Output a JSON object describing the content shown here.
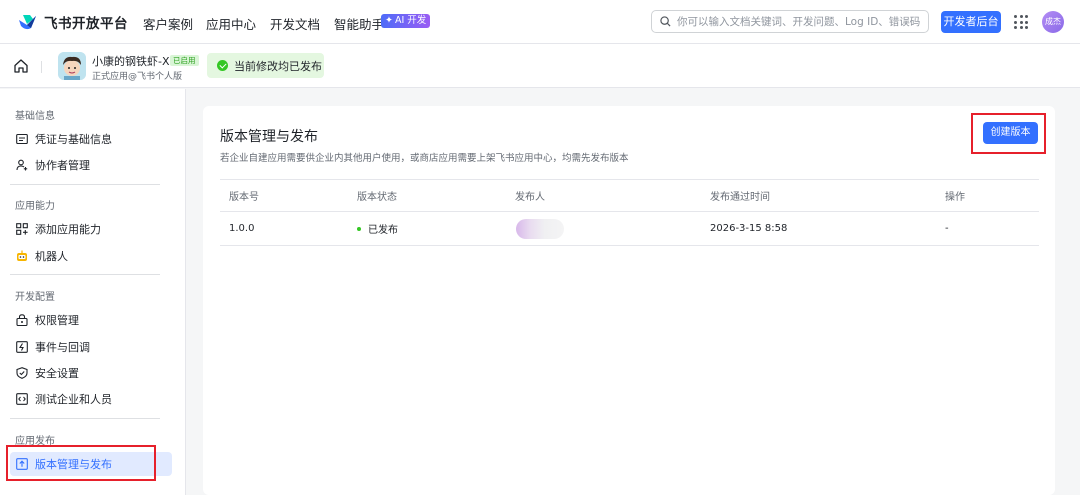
{
  "topbar": {
    "logo_text": "飞书开放平台",
    "nav": [
      "客户案例",
      "应用中心",
      "开发文档",
      "智能助手"
    ],
    "ai_badge": "AI 开发",
    "search_placeholder": "你可以输入文档关键词、开发问题、Log ID、错误码",
    "dev_console_label": "开发者后台",
    "user_avatar_text": "成杰"
  },
  "subbar": {
    "app_name": "小康的钢铁虾-XF",
    "app_status_tag": "已启用",
    "app_sub": "正式应用@飞书个人版",
    "published_status": "当前修改均已发布"
  },
  "sidebar": {
    "sections": [
      {
        "title": "基础信息",
        "items": [
          "凭证与基础信息",
          "协作者管理"
        ]
      },
      {
        "title": "应用能力",
        "items": [
          "添加应用能力",
          "机器人"
        ]
      },
      {
        "title": "开发配置",
        "items": [
          "权限管理",
          "事件与回调",
          "安全设置",
          "测试企业和人员"
        ]
      },
      {
        "title": "应用发布",
        "items": [
          "版本管理与发布"
        ]
      }
    ],
    "active_item": "版本管理与发布"
  },
  "main": {
    "title": "版本管理与发布",
    "description": "若企业自建应用需要供企业内其他用户使用，或商店应用需要上架飞书应用中心，均需先发布版本",
    "create_button": "创建版本",
    "table": {
      "headers": [
        "版本号",
        "版本状态",
        "发布人",
        "发布通过时间",
        "操作"
      ],
      "rows": [
        {
          "version": "1.0.0",
          "status": "已发布",
          "publisher": "",
          "time": "2026-3-15 8:58",
          "action": "-"
        }
      ]
    }
  },
  "colors": {
    "brand": "#3370ff",
    "success": "#34c724",
    "highlight": "#e6202b"
  }
}
